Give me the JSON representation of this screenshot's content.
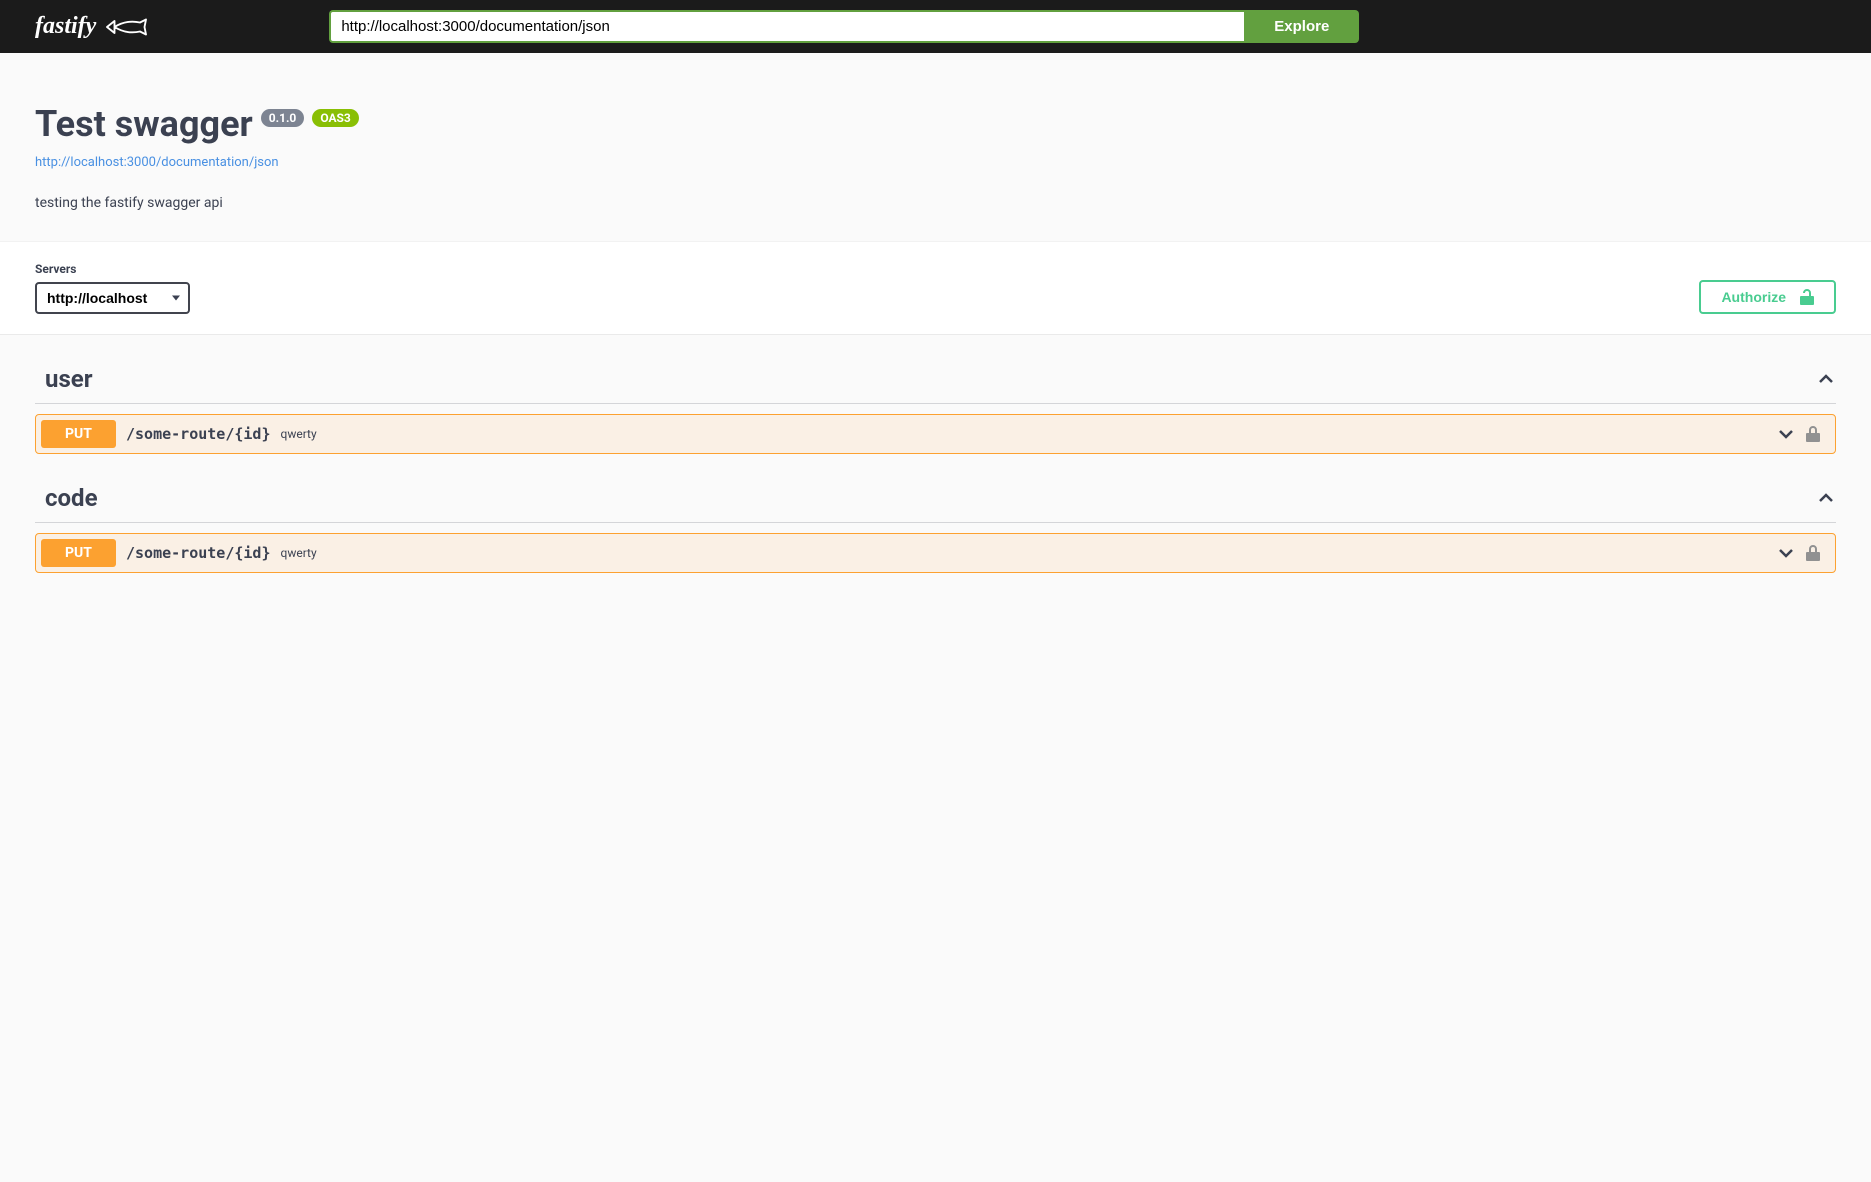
{
  "topbar": {
    "logo_text": "fastify",
    "url_value": "http://localhost:3000/documentation/json",
    "explore_label": "Explore"
  },
  "info": {
    "title": "Test swagger",
    "version": "0.1.0",
    "oas_label": "OAS3",
    "spec_url": "http://localhost:3000/documentation/json",
    "description": "testing the fastify swagger api"
  },
  "servers": {
    "label": "Servers",
    "selected": "http://localhost"
  },
  "authorize_label": "Authorize",
  "tags": [
    {
      "name": "user",
      "ops": [
        {
          "method": "PUT",
          "path": "/some-route/{id}",
          "summary": "qwerty"
        }
      ]
    },
    {
      "name": "code",
      "ops": [
        {
          "method": "PUT",
          "path": "/some-route/{id}",
          "summary": "qwerty"
        }
      ]
    }
  ]
}
